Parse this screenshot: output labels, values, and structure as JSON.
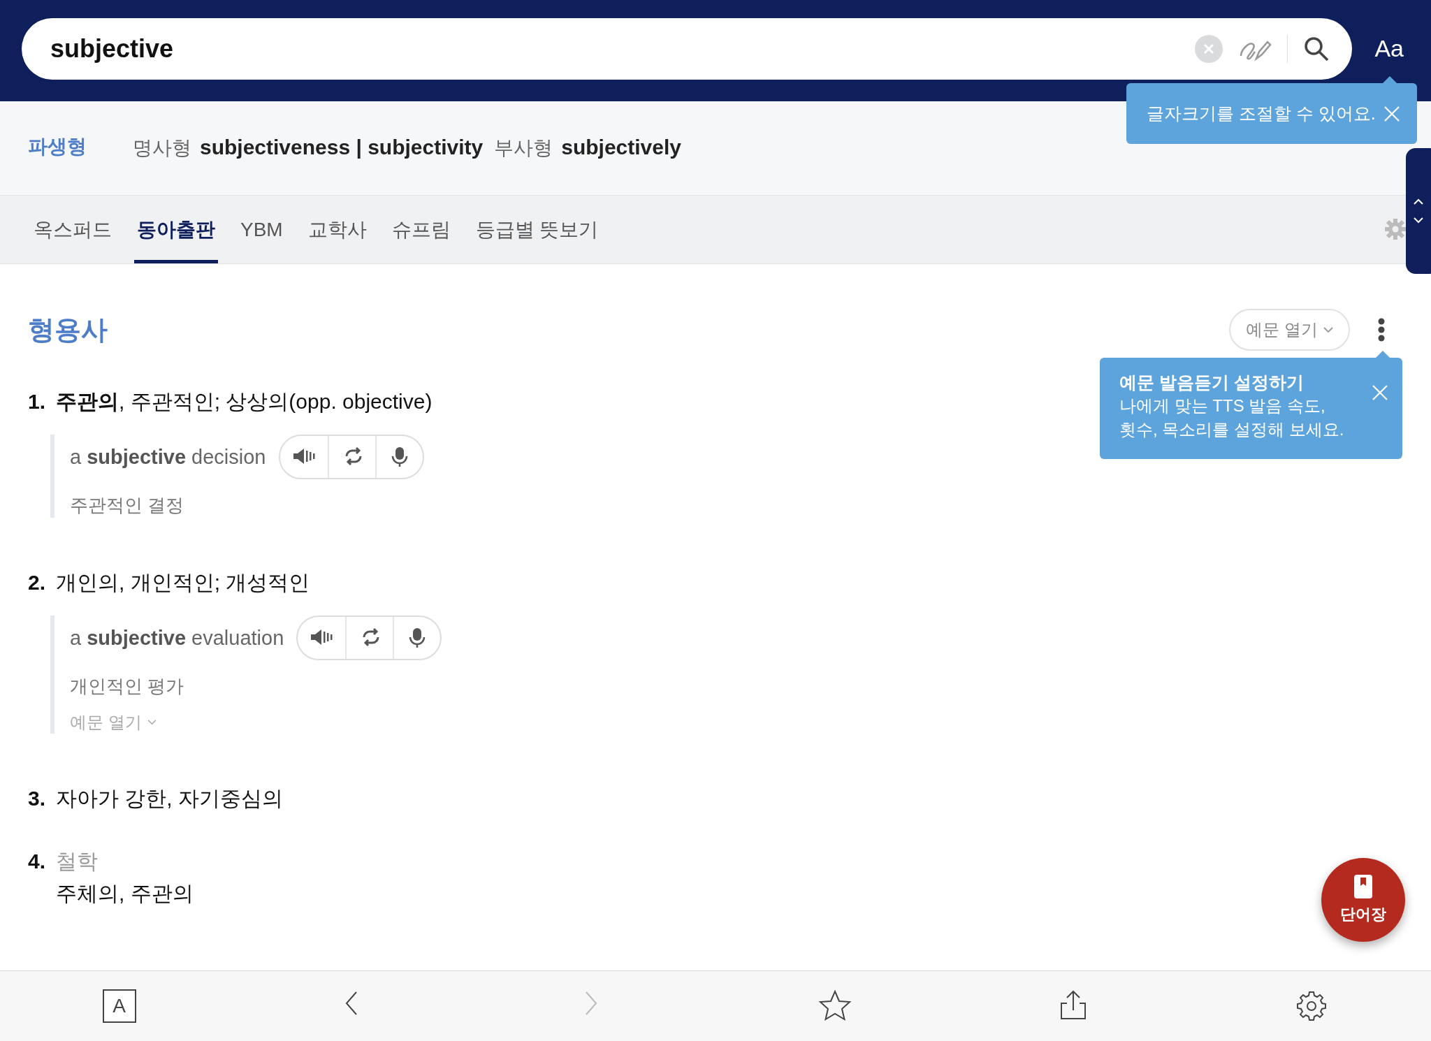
{
  "search": {
    "value": "subjective"
  },
  "font_size_button": "Aa",
  "font_tip": {
    "text": "글자크기를 조절할 수 있어요."
  },
  "derivatives": {
    "label": "파생형",
    "groups": [
      {
        "label": "명사형",
        "words": "subjectiveness | subjectivity"
      },
      {
        "label": "부사형",
        "words": "subjectively"
      }
    ]
  },
  "tabs": [
    {
      "label": "옥스퍼드",
      "selected": false
    },
    {
      "label": "동아출판",
      "selected": true
    },
    {
      "label": "YBM",
      "selected": false
    },
    {
      "label": "교학사",
      "selected": false
    },
    {
      "label": "슈프림",
      "selected": false
    },
    {
      "label": "등급별 뜻보기",
      "selected": false
    }
  ],
  "part_of_speech": "형용사",
  "examples_toggle": "예문 열기",
  "tts_tip": {
    "title": "예문 발음듣기 설정하기",
    "body": "나에게 맞는 TTS 발음 속도, 횟수, 목소리를 설정해 보세요."
  },
  "senses": [
    {
      "number": "1.",
      "text": "**주관의**, 주관적인; 상상의(opp. objective)",
      "examples": [
        {
          "text": "a **subjective** decision",
          "translation": "주관적인 결정"
        }
      ]
    },
    {
      "number": "2.",
      "text": "개인의, 개인적인; 개성적인",
      "examples": [
        {
          "text": "a **subjective** evaluation",
          "translation": "개인적인 평가"
        }
      ],
      "more": "예문 열기"
    },
    {
      "number": "3.",
      "text": "자아가 강한, 자기중심의"
    },
    {
      "number": "4.",
      "field": "철학",
      "text": "주체의, 주관의"
    }
  ],
  "fab": {
    "label": "단어장"
  },
  "bottom_bar": [
    {
      "kind": "text",
      "label": "A",
      "disabled": false
    },
    {
      "kind": "back",
      "disabled": false
    },
    {
      "kind": "forward",
      "disabled": true
    },
    {
      "kind": "star",
      "disabled": false
    },
    {
      "kind": "share",
      "disabled": false
    },
    {
      "kind": "settings",
      "disabled": false
    }
  ]
}
